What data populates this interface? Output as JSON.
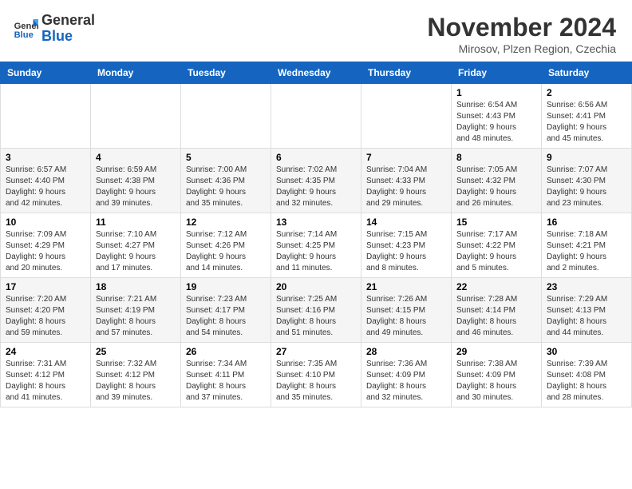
{
  "header": {
    "logo_line1": "General",
    "logo_line2": "Blue",
    "month_title": "November 2024",
    "subtitle": "Mirosov, Plzen Region, Czechia"
  },
  "days_of_week": [
    "Sunday",
    "Monday",
    "Tuesday",
    "Wednesday",
    "Thursday",
    "Friday",
    "Saturday"
  ],
  "weeks": [
    [
      {
        "day": "",
        "info": ""
      },
      {
        "day": "",
        "info": ""
      },
      {
        "day": "",
        "info": ""
      },
      {
        "day": "",
        "info": ""
      },
      {
        "day": "",
        "info": ""
      },
      {
        "day": "1",
        "info": "Sunrise: 6:54 AM\nSunset: 4:43 PM\nDaylight: 9 hours\nand 48 minutes."
      },
      {
        "day": "2",
        "info": "Sunrise: 6:56 AM\nSunset: 4:41 PM\nDaylight: 9 hours\nand 45 minutes."
      }
    ],
    [
      {
        "day": "3",
        "info": "Sunrise: 6:57 AM\nSunset: 4:40 PM\nDaylight: 9 hours\nand 42 minutes."
      },
      {
        "day": "4",
        "info": "Sunrise: 6:59 AM\nSunset: 4:38 PM\nDaylight: 9 hours\nand 39 minutes."
      },
      {
        "day": "5",
        "info": "Sunrise: 7:00 AM\nSunset: 4:36 PM\nDaylight: 9 hours\nand 35 minutes."
      },
      {
        "day": "6",
        "info": "Sunrise: 7:02 AM\nSunset: 4:35 PM\nDaylight: 9 hours\nand 32 minutes."
      },
      {
        "day": "7",
        "info": "Sunrise: 7:04 AM\nSunset: 4:33 PM\nDaylight: 9 hours\nand 29 minutes."
      },
      {
        "day": "8",
        "info": "Sunrise: 7:05 AM\nSunset: 4:32 PM\nDaylight: 9 hours\nand 26 minutes."
      },
      {
        "day": "9",
        "info": "Sunrise: 7:07 AM\nSunset: 4:30 PM\nDaylight: 9 hours\nand 23 minutes."
      }
    ],
    [
      {
        "day": "10",
        "info": "Sunrise: 7:09 AM\nSunset: 4:29 PM\nDaylight: 9 hours\nand 20 minutes."
      },
      {
        "day": "11",
        "info": "Sunrise: 7:10 AM\nSunset: 4:27 PM\nDaylight: 9 hours\nand 17 minutes."
      },
      {
        "day": "12",
        "info": "Sunrise: 7:12 AM\nSunset: 4:26 PM\nDaylight: 9 hours\nand 14 minutes."
      },
      {
        "day": "13",
        "info": "Sunrise: 7:14 AM\nSunset: 4:25 PM\nDaylight: 9 hours\nand 11 minutes."
      },
      {
        "day": "14",
        "info": "Sunrise: 7:15 AM\nSunset: 4:23 PM\nDaylight: 9 hours\nand 8 minutes."
      },
      {
        "day": "15",
        "info": "Sunrise: 7:17 AM\nSunset: 4:22 PM\nDaylight: 9 hours\nand 5 minutes."
      },
      {
        "day": "16",
        "info": "Sunrise: 7:18 AM\nSunset: 4:21 PM\nDaylight: 9 hours\nand 2 minutes."
      }
    ],
    [
      {
        "day": "17",
        "info": "Sunrise: 7:20 AM\nSunset: 4:20 PM\nDaylight: 8 hours\nand 59 minutes."
      },
      {
        "day": "18",
        "info": "Sunrise: 7:21 AM\nSunset: 4:19 PM\nDaylight: 8 hours\nand 57 minutes."
      },
      {
        "day": "19",
        "info": "Sunrise: 7:23 AM\nSunset: 4:17 PM\nDaylight: 8 hours\nand 54 minutes."
      },
      {
        "day": "20",
        "info": "Sunrise: 7:25 AM\nSunset: 4:16 PM\nDaylight: 8 hours\nand 51 minutes."
      },
      {
        "day": "21",
        "info": "Sunrise: 7:26 AM\nSunset: 4:15 PM\nDaylight: 8 hours\nand 49 minutes."
      },
      {
        "day": "22",
        "info": "Sunrise: 7:28 AM\nSunset: 4:14 PM\nDaylight: 8 hours\nand 46 minutes."
      },
      {
        "day": "23",
        "info": "Sunrise: 7:29 AM\nSunset: 4:13 PM\nDaylight: 8 hours\nand 44 minutes."
      }
    ],
    [
      {
        "day": "24",
        "info": "Sunrise: 7:31 AM\nSunset: 4:12 PM\nDaylight: 8 hours\nand 41 minutes."
      },
      {
        "day": "25",
        "info": "Sunrise: 7:32 AM\nSunset: 4:12 PM\nDaylight: 8 hours\nand 39 minutes."
      },
      {
        "day": "26",
        "info": "Sunrise: 7:34 AM\nSunset: 4:11 PM\nDaylight: 8 hours\nand 37 minutes."
      },
      {
        "day": "27",
        "info": "Sunrise: 7:35 AM\nSunset: 4:10 PM\nDaylight: 8 hours\nand 35 minutes."
      },
      {
        "day": "28",
        "info": "Sunrise: 7:36 AM\nSunset: 4:09 PM\nDaylight: 8 hours\nand 32 minutes."
      },
      {
        "day": "29",
        "info": "Sunrise: 7:38 AM\nSunset: 4:09 PM\nDaylight: 8 hours\nand 30 minutes."
      },
      {
        "day": "30",
        "info": "Sunrise: 7:39 AM\nSunset: 4:08 PM\nDaylight: 8 hours\nand 28 minutes."
      }
    ]
  ]
}
